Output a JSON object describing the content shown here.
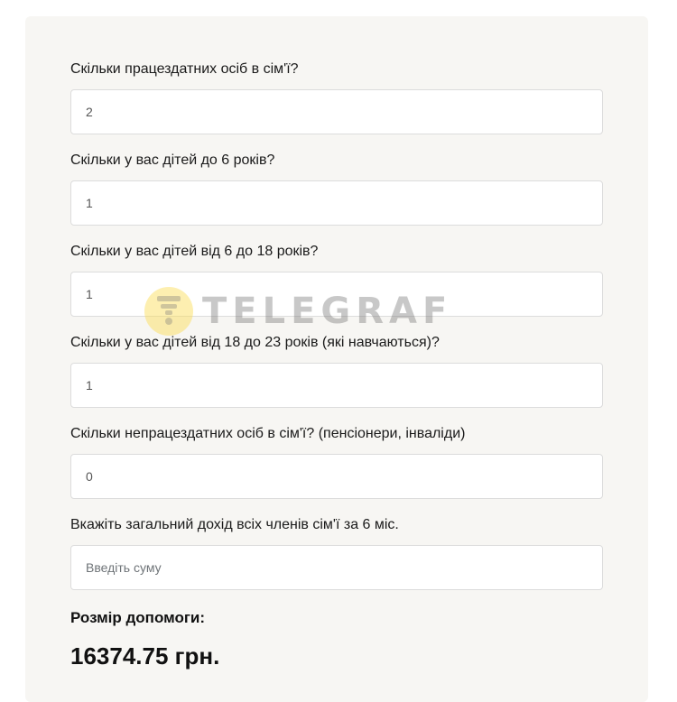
{
  "form": {
    "fields": [
      {
        "label": "Скільки працездатних осіб в сім'ї?",
        "value": "2",
        "placeholder": ""
      },
      {
        "label": "Скільки у вас дітей до 6 років?",
        "value": "1",
        "placeholder": ""
      },
      {
        "label": "Скільки у вас дітей від 6 до 18 років?",
        "value": "1",
        "placeholder": ""
      },
      {
        "label": "Скільки у вас дітей від 18 до 23 років (які навчаються)?",
        "value": "1",
        "placeholder": ""
      },
      {
        "label": "Скільки непрацездатних осіб в сім'ї? (пенсіонери, інваліди)",
        "value": "0",
        "placeholder": ""
      },
      {
        "label": "Вкажіть загальний дохід всіх членів сім'ї за 6 міс.",
        "value": "",
        "placeholder": "Введіть суму"
      }
    ]
  },
  "result": {
    "label": "Розмір допомоги:",
    "value": "16374.75 грн."
  },
  "watermark": {
    "text": "TELEGRAF",
    "color": "#fadc50"
  }
}
